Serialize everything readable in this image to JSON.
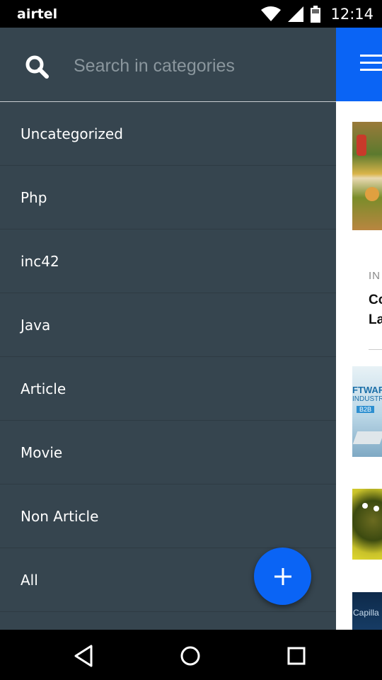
{
  "status_bar": {
    "carrier": "airtel",
    "time": "12:14",
    "icons": [
      "wifi-icon",
      "signal-icon",
      "battery-icon"
    ]
  },
  "drawer": {
    "search": {
      "placeholder": "Search in categories",
      "value": "",
      "icon": "search-icon"
    },
    "categories": [
      {
        "label": "Uncategorized"
      },
      {
        "label": "Php"
      },
      {
        "label": "inc42"
      },
      {
        "label": "Java"
      },
      {
        "label": "Article"
      },
      {
        "label": "Movie"
      },
      {
        "label": "Non Article"
      },
      {
        "label": "All"
      }
    ]
  },
  "background": {
    "appbar_icon": "menu-icon",
    "category_tag": "IN",
    "title_lines": [
      "Co",
      "La"
    ],
    "thumb_text_1": "FTWARE",
    "thumb_text_2": "INDUSTRY",
    "thumb_text_3": "B2B",
    "thumb_text_4": "Capilla"
  },
  "fab": {
    "icon": "plus-icon"
  },
  "nav_bar": {
    "icons": [
      "back-icon",
      "home-icon",
      "recents-icon"
    ]
  },
  "colors": {
    "drawer_bg": "#36454f",
    "accent": "#0a64f5",
    "text": "#ffffff",
    "placeholder": "#8a969d"
  }
}
